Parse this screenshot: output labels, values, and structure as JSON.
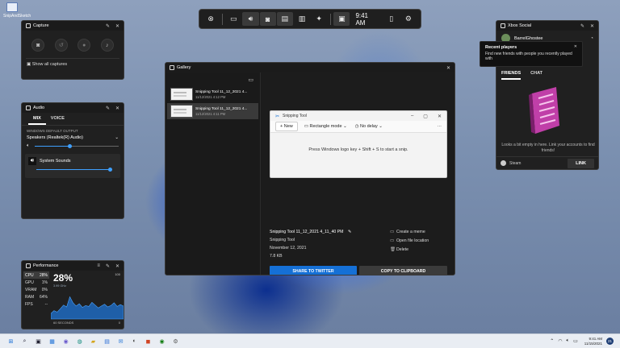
{
  "desktop": {
    "icon_label": "SnipAndSketch"
  },
  "topbar": {
    "time": "9:41 AM",
    "buttons": [
      "xbox-icon",
      "widget-icon",
      "audio-icon",
      "capture-icon",
      "performance-icon",
      "resources-icon",
      "controller-icon",
      "gallery-icon",
      "mouse-icon",
      "settings-icon"
    ]
  },
  "capture": {
    "title": "Capture",
    "show_all": "Show all captures"
  },
  "audio": {
    "title": "Audio",
    "tab_mix": "MIX",
    "tab_voice": "VOICE",
    "default_output_label": "WINDOWS DEFAULT OUTPUT",
    "device": "Speakers (Realtek(R) Audio)",
    "device_volume": 0.42,
    "app_name": "System Sounds",
    "app_volume": 1.0
  },
  "performance": {
    "title": "Performance",
    "items": [
      {
        "label": "CPU",
        "value": "28%"
      },
      {
        "label": "GPU",
        "value": "1%"
      },
      {
        "label": "VRAM",
        "value": "0%"
      },
      {
        "label": "RAM",
        "value": "64%"
      },
      {
        "label": "FPS",
        "value": "--"
      }
    ],
    "big_value": "28%",
    "sub_label": "3.99 GHz",
    "max_label": "100",
    "duration_label": "60 SECONDS",
    "min_label": "0",
    "cpu_samples": [
      12,
      18,
      15,
      22,
      30,
      26,
      48,
      35,
      28,
      33,
      25,
      29,
      27,
      36,
      30,
      24,
      28,
      32,
      26,
      29,
      35,
      27,
      31,
      28
    ]
  },
  "xbox_social": {
    "title": "Xbox Social",
    "username": "BarrelGhostee",
    "tooltip_title": "Recent players",
    "tooltip_body": "Find new friends with people you recently played with",
    "tab_friends": "FRIENDS",
    "tab_chat": "CHAT",
    "empty_text": "Looks a bit empty in here. Link your accounts to find friends!",
    "steam_label": "Steam",
    "link_label": "LINK"
  },
  "gallery": {
    "title": "Gallery",
    "items": [
      {
        "name": "Snipping Tool 11_12_2021 4...",
        "date": "11/12/2021 4:12 PM"
      },
      {
        "name": "Snipping Tool 11_12_2021 4...",
        "date": "11/12/2021 4:11 PM"
      }
    ],
    "snip": {
      "title": "Snipping Tool",
      "new_label": "New",
      "mode_label": "Rectangle mode",
      "delay_label": "No delay",
      "message": "Press Windows logo key + Shift + S to start a snip."
    },
    "file_name": "Snipping Tool 11_12_2021 4_11_40 PM",
    "app": "Snipping Tool",
    "date": "November 12, 2021",
    "size": "7.8 KB",
    "action_meme": "Create a meme",
    "action_open": "Open file location",
    "action_delete": "Delete",
    "share_label": "SHARE TO TWITTER",
    "copy_label": "COPY TO CLIPBOARD"
  },
  "taskbar": {
    "clock_time": "9:41 AM",
    "clock_date": "11/15/2021",
    "notifications": "21"
  }
}
